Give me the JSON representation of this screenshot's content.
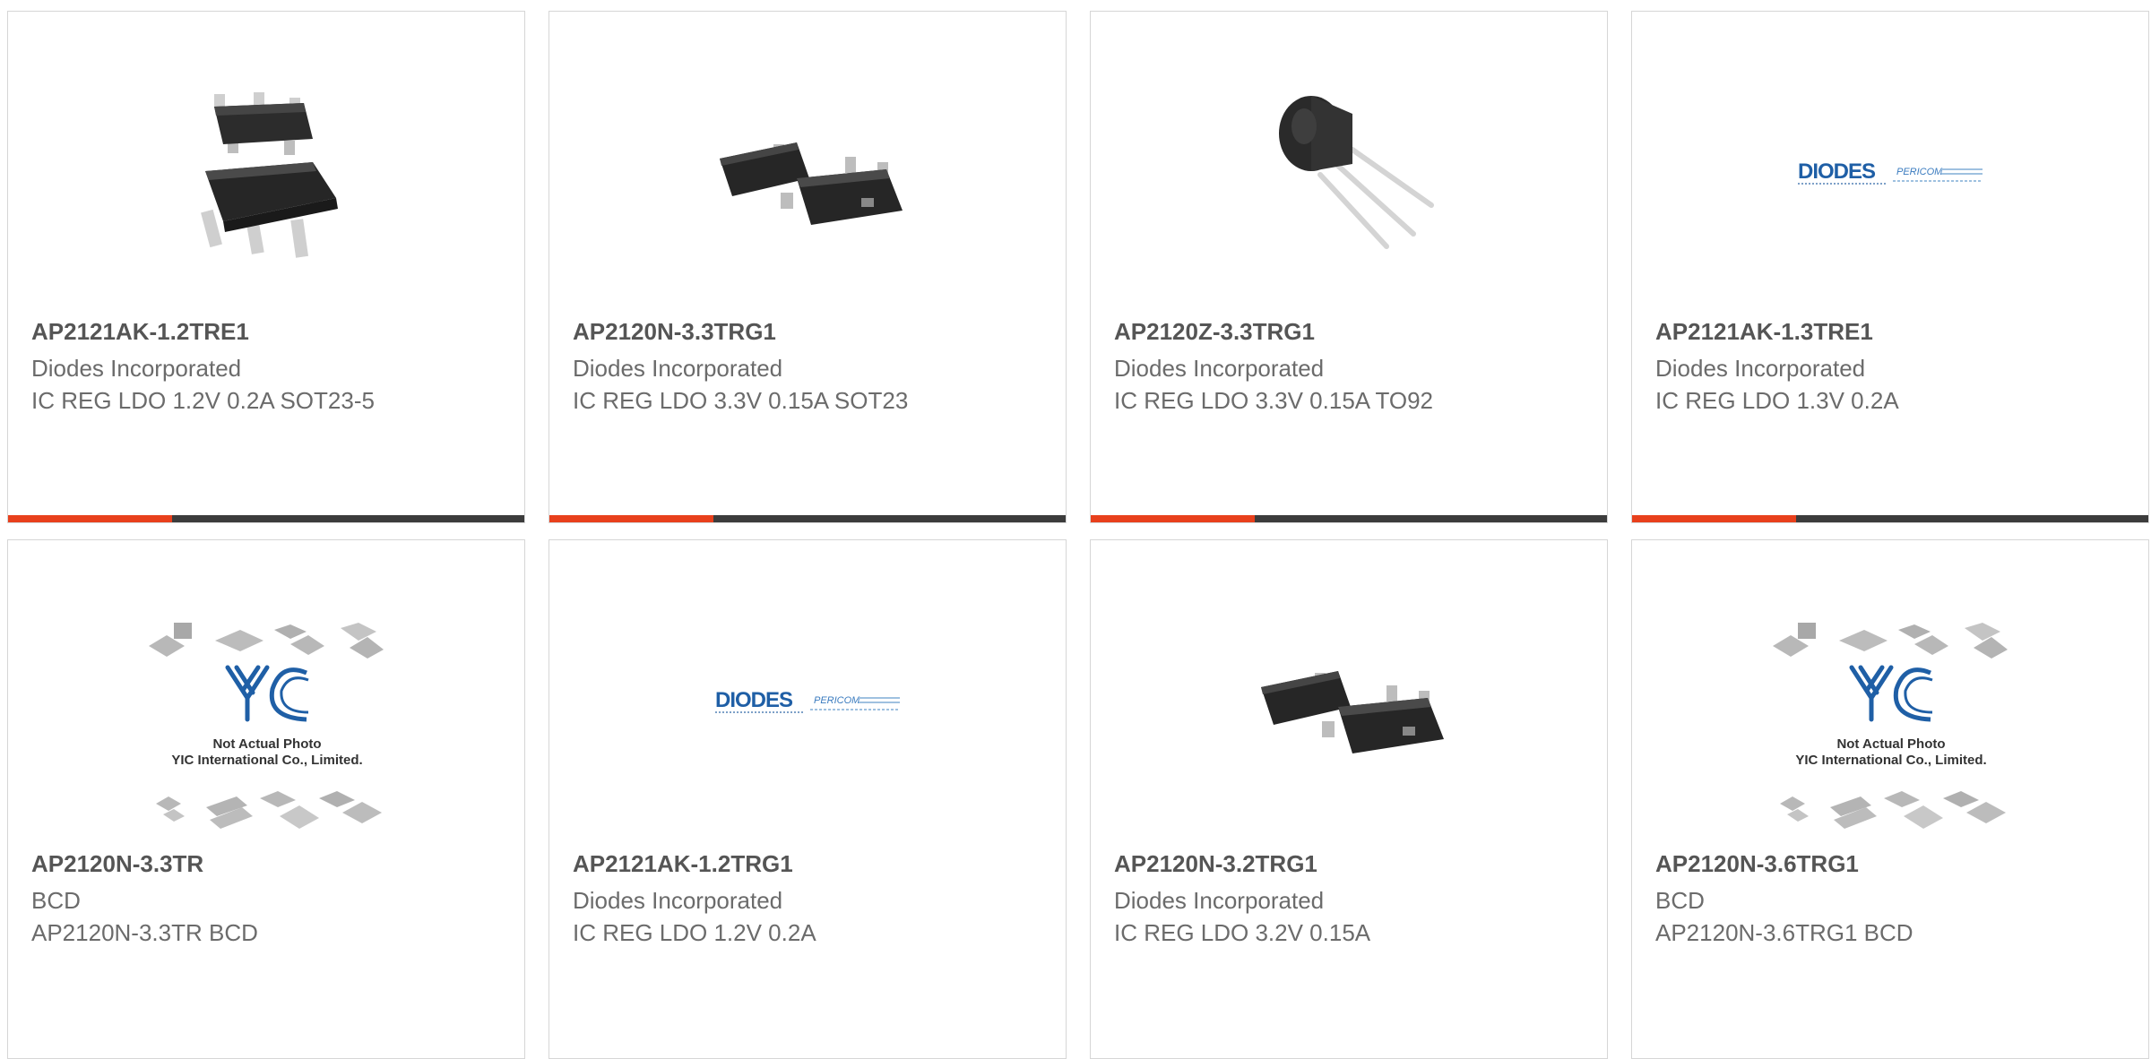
{
  "products": [
    {
      "part": "AP2121AK-1.2TRE1",
      "manufacturer": "Diodes Incorporated",
      "description": "IC REG LDO 1.2V 0.2A SOT23-5",
      "image": "sot23-5-package"
    },
    {
      "part": "AP2120N-3.3TRG1",
      "manufacturer": "Diodes Incorporated",
      "description": "IC REG LDO 3.3V 0.15A SOT23",
      "image": "sot23-package"
    },
    {
      "part": "AP2120Z-3.3TRG1",
      "manufacturer": "Diodes Incorporated",
      "description": "IC REG LDO 3.3V 0.15A TO92",
      "image": "to92-package"
    },
    {
      "part": "AP2121AK-1.3TRE1",
      "manufacturer": "Diodes Incorporated",
      "description": "IC REG LDO 1.3V 0.2A",
      "image": "diodes-pericom-logo"
    },
    {
      "part": "AP2120N-3.3TR",
      "manufacturer": "BCD",
      "description": "AP2120N-3.3TR BCD",
      "image": "yic-placeholder"
    },
    {
      "part": "AP2121AK-1.2TRG1",
      "manufacturer": "Diodes Incorporated",
      "description": "IC REG LDO 1.2V 0.2A",
      "image": "diodes-pericom-logo"
    },
    {
      "part": "AP2120N-3.2TRG1",
      "manufacturer": "Diodes Incorporated",
      "description": "IC REG LDO 3.2V 0.15A",
      "image": "sot23-package"
    },
    {
      "part": "AP2120N-3.6TRG1",
      "manufacturer": "BCD",
      "description": "AP2120N-3.6TRG1 BCD",
      "image": "yic-placeholder"
    }
  ],
  "logo_text": {
    "diodes": "DIODES",
    "pericom": "PERICOM"
  },
  "placeholder_text": {
    "line1": "Not Actual Photo",
    "line2": "YIC International Co., Limited."
  },
  "colors": {
    "accent": "#e8401c",
    "bar": "#3c3c3c",
    "border": "#d6d6d6",
    "brand_blue": "#1f5fa6"
  }
}
